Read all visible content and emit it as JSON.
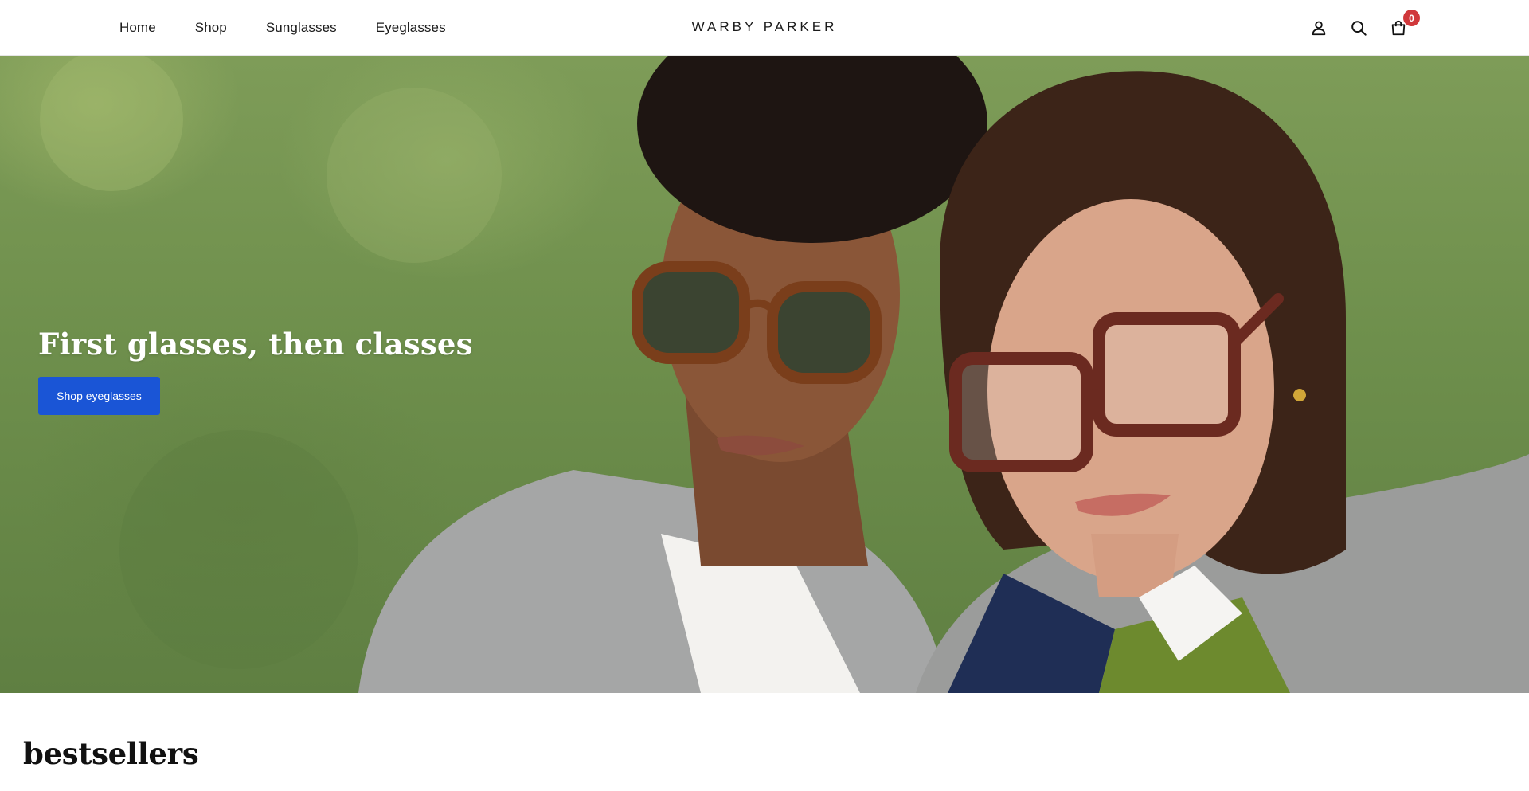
{
  "header": {
    "nav": [
      {
        "label": "Home"
      },
      {
        "label": "Shop"
      },
      {
        "label": "Sunglasses"
      },
      {
        "label": "Eyeglasses"
      }
    ],
    "logo": "WARBY PARKER",
    "icons": [
      "user-icon",
      "search-icon",
      "cart-icon"
    ],
    "cart_count": "0"
  },
  "hero": {
    "title": "First glasses, then classes",
    "cta_label": "Shop eyeglasses"
  },
  "bestsellers": {
    "title": "bestsellers"
  },
  "colors": {
    "accent": "#1a55d6",
    "badge": "#d0383b",
    "text": "#111111"
  }
}
